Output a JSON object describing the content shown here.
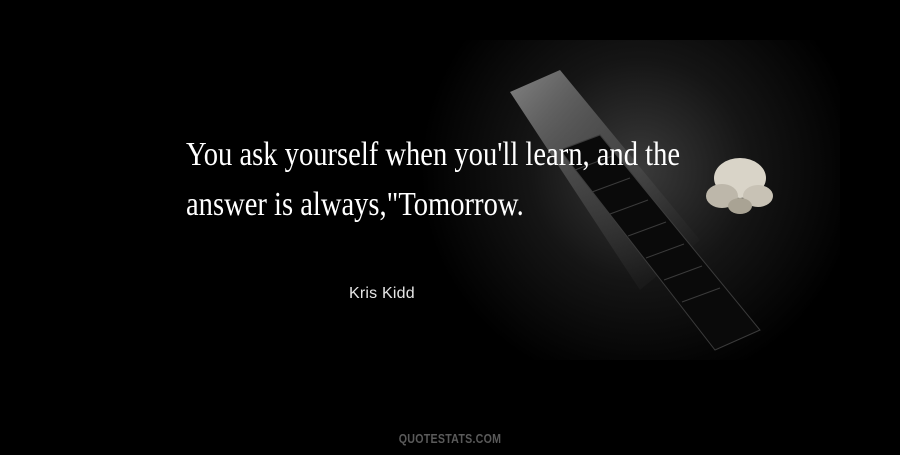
{
  "quote": {
    "line1": "You ask yourself when you'll learn, and the",
    "line2": "answer is always,\"Tomorrow."
  },
  "author": "Kris Kidd",
  "watermark": "QUOTESTATS.COM",
  "colors": {
    "background": "#000000",
    "quote_text": "#ffffff",
    "author_text": "#e6e6e6",
    "watermark_text": "#5a5a5a"
  },
  "background_image": "piano-keys-spotlight-with-flower"
}
